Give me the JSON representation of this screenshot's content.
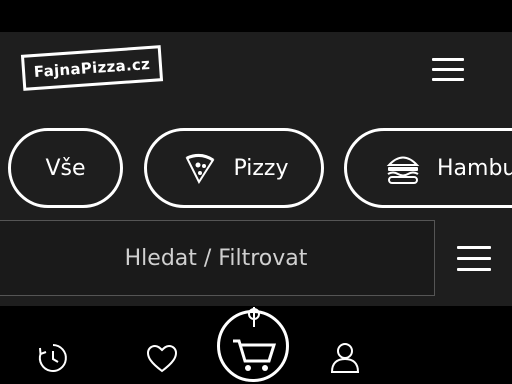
{
  "header": {
    "logo_text": "FajnaPizza.cz",
    "menu_icon": "hamburger-icon"
  },
  "categories": [
    {
      "label": "Vše",
      "icon": ""
    },
    {
      "label": "Pizzy",
      "icon": "pizza-icon"
    },
    {
      "label": "Hamburgery",
      "icon": "burger-icon"
    }
  ],
  "filter": {
    "search_label": "Hledat / Filtrovat",
    "menu_icon": "hamburger-icon"
  },
  "bottom_nav": {
    "items": [
      "history-icon",
      "heart-icon",
      "cart-icon",
      "user-icon"
    ]
  },
  "colors": {
    "background": "#000000",
    "panel": "#1e1e1e",
    "foreground": "#ffffff"
  }
}
